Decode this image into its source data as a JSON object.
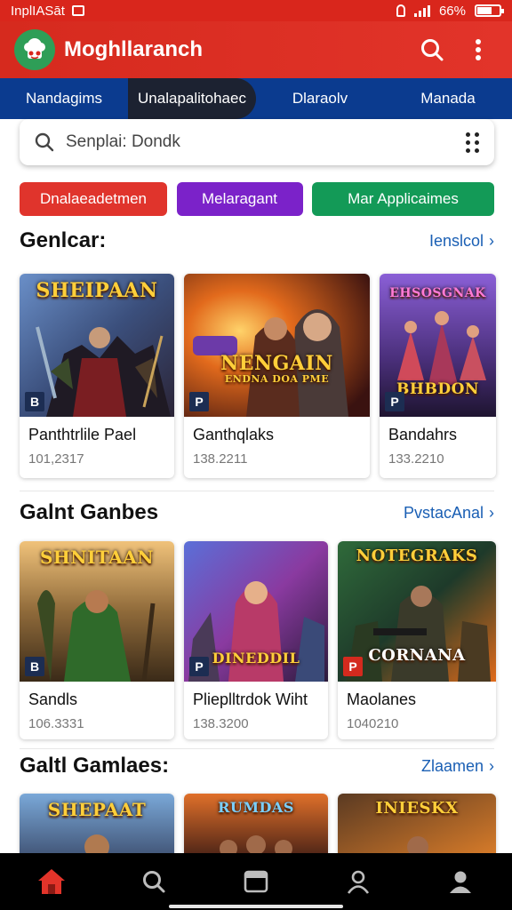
{
  "status_bar": {
    "carrier": "InplIASāt",
    "battery": "66%",
    "battery_level": 0.66
  },
  "app_bar": {
    "title": "Moghllaranch",
    "logo_icon": "chef-logo",
    "search_icon": "search-icon",
    "menu_icon": "more-vert-icon"
  },
  "tabs": [
    {
      "label": "Nandagims"
    },
    {
      "label": "Unalapalitohaec"
    },
    {
      "label": "Dlaraolv"
    },
    {
      "label": "Manada"
    }
  ],
  "search": {
    "placeholder": "Senplai: Dondk"
  },
  "chips": [
    {
      "label": "Dnalaeadetmen",
      "color": "#e0342c"
    },
    {
      "label": "Melaragant",
      "color": "#7b22c9"
    },
    {
      "label": "Mar Applicaimes",
      "color": "#139a57"
    }
  ],
  "sections": [
    {
      "title": "Genlcar:",
      "more": "Ienslcol",
      "cards": [
        {
          "art_title": "SHEIPAAN",
          "name": "Panthtrlile Pael",
          "meta": "101,2317",
          "badge": "B"
        },
        {
          "art_title": "NENGAIN",
          "art_sub": "ENDNA DOA PME",
          "name": "Ganthqlaks",
          "meta": "138.2211",
          "badge": "P"
        },
        {
          "art_title": "EHSOSGNAK",
          "art_sub2": "BHBDON",
          "name": "Bandahrs",
          "meta": "133.2210",
          "badge": "P"
        }
      ]
    },
    {
      "title": "Galnt Ganbes",
      "more": "PvstacAnal",
      "cards": [
        {
          "art_title": "SHNITAAN",
          "name": "Sandls",
          "meta": "106.3331",
          "badge": "B"
        },
        {
          "art_title": "DINEDDIL",
          "name": "Plieplltrdok Wiht",
          "meta": "138.3200",
          "badge": "P"
        },
        {
          "art_title": "NOTEGRAKS",
          "art_sub": "CORNANA",
          "name": "Maolanes",
          "meta": "1040210",
          "badge": "P"
        }
      ]
    },
    {
      "title": "Galtl Gamlaes:",
      "more": "Zlaamen",
      "cards": [
        {
          "art_title": "SHEPAAT"
        },
        {
          "art_title": "RUMDAS"
        },
        {
          "art_title": "INIESKX"
        }
      ]
    }
  ],
  "bottom_nav": [
    {
      "icon": "home-icon"
    },
    {
      "icon": "search-icon"
    },
    {
      "icon": "library-icon"
    },
    {
      "icon": "profile-icon"
    },
    {
      "icon": "account-icon"
    }
  ],
  "colors": {
    "primary": "#d9261c",
    "tab_bar": "#0b3b8f",
    "link": "#1a5fb4"
  }
}
